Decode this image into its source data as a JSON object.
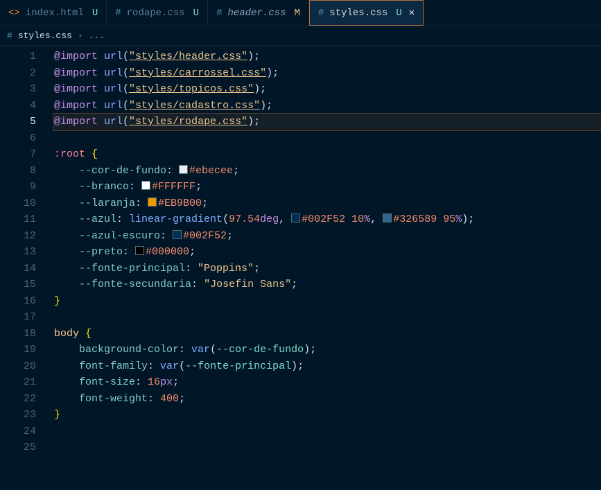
{
  "tabs": [
    {
      "icon": "html",
      "label": "index.html",
      "mod": "U",
      "modClass": "u",
      "active": false,
      "italic": false
    },
    {
      "icon": "css",
      "label": "rodape.css",
      "mod": "U",
      "modClass": "u",
      "active": false,
      "italic": false
    },
    {
      "icon": "css",
      "label": "header.css",
      "mod": "M",
      "modClass": "m",
      "active": false,
      "italic": true
    },
    {
      "icon": "css",
      "label": "styles.css",
      "mod": "U",
      "modClass": "u",
      "active": true,
      "italic": false,
      "closable": true
    }
  ],
  "breadcrumb": {
    "icon": "css",
    "file": "styles.css",
    "trail": "..."
  },
  "currentLine": 5,
  "glyphs": {
    "close": "✕",
    "crumbSep": "›",
    "htmlIcon": "<>",
    "cssIcon": "#"
  },
  "code": [
    {
      "n": 1,
      "seg": [
        [
          "at",
          "@import "
        ],
        [
          "fn",
          "url"
        ],
        [
          "paren",
          "("
        ],
        [
          "str",
          "\"styles/header.css\""
        ],
        [
          "paren",
          ")"
        ],
        [
          "punc",
          ";"
        ]
      ]
    },
    {
      "n": 2,
      "seg": [
        [
          "at",
          "@import "
        ],
        [
          "fn",
          "url"
        ],
        [
          "paren",
          "("
        ],
        [
          "str",
          "\"styles/carrossel.css\""
        ],
        [
          "paren",
          ")"
        ],
        [
          "punc",
          ";"
        ]
      ]
    },
    {
      "n": 3,
      "seg": [
        [
          "at",
          "@import "
        ],
        [
          "fn",
          "url"
        ],
        [
          "paren",
          "("
        ],
        [
          "str",
          "\"styles/topicos.css\""
        ],
        [
          "paren",
          ")"
        ],
        [
          "punc",
          ";"
        ]
      ]
    },
    {
      "n": 4,
      "seg": [
        [
          "at",
          "@import "
        ],
        [
          "fn",
          "url"
        ],
        [
          "paren",
          "("
        ],
        [
          "str",
          "\"styles/cadastro.css\""
        ],
        [
          "paren",
          ")"
        ],
        [
          "punc",
          ";"
        ]
      ]
    },
    {
      "n": 5,
      "hl": true,
      "seg": [
        [
          "at",
          "@import "
        ],
        [
          "fn",
          "url"
        ],
        [
          "paren",
          "("
        ],
        [
          "str",
          "\"styles/rodape.css\""
        ],
        [
          "paren",
          ")"
        ],
        [
          "punc",
          ";"
        ]
      ]
    },
    {
      "n": 6,
      "seg": []
    },
    {
      "n": 7,
      "seg": [
        [
          "sel2",
          ":root"
        ],
        [
          "punc",
          " "
        ],
        [
          "brace",
          "{"
        ]
      ]
    },
    {
      "n": 8,
      "seg": [
        [
          "prop",
          "    --cor-de-fundo"
        ],
        [
          "punc",
          ": "
        ],
        [
          "swatch",
          "#ebecee"
        ],
        [
          "hex",
          "#ebecee"
        ],
        [
          "punc",
          ";"
        ]
      ]
    },
    {
      "n": 9,
      "seg": [
        [
          "prop",
          "    --branco"
        ],
        [
          "punc",
          ": "
        ],
        [
          "swatch",
          "#FFFFFF"
        ],
        [
          "hex",
          "#FFFFFF"
        ],
        [
          "punc",
          ";"
        ]
      ]
    },
    {
      "n": 10,
      "seg": [
        [
          "prop",
          "    --laranja"
        ],
        [
          "punc",
          ": "
        ],
        [
          "swatch",
          "#EB9B00"
        ],
        [
          "hex",
          "#EB9B00"
        ],
        [
          "punc",
          ";"
        ]
      ]
    },
    {
      "n": 11,
      "seg": [
        [
          "prop",
          "    --azul"
        ],
        [
          "punc",
          ": "
        ],
        [
          "fn",
          "linear-gradient"
        ],
        [
          "paren",
          "("
        ],
        [
          "num",
          "97.54"
        ],
        [
          "unit",
          "deg"
        ],
        [
          "punc",
          ", "
        ],
        [
          "swatch",
          "#002F52"
        ],
        [
          "hex",
          "#002F52"
        ],
        [
          "punc",
          " "
        ],
        [
          "num",
          "10"
        ],
        [
          "unit",
          "%"
        ],
        [
          "punc",
          ", "
        ],
        [
          "swatch",
          "#326589"
        ],
        [
          "hex",
          "#326589"
        ],
        [
          "punc",
          " "
        ],
        [
          "num",
          "95"
        ],
        [
          "unit",
          "%"
        ],
        [
          "paren",
          ")"
        ],
        [
          "punc",
          ";"
        ]
      ]
    },
    {
      "n": 12,
      "seg": [
        [
          "prop",
          "    --azul-escuro"
        ],
        [
          "punc",
          ": "
        ],
        [
          "swatch",
          "#002F52"
        ],
        [
          "hex",
          "#002F52"
        ],
        [
          "punc",
          ";"
        ]
      ]
    },
    {
      "n": 13,
      "seg": [
        [
          "prop",
          "    --preto"
        ],
        [
          "punc",
          ": "
        ],
        [
          "swatch",
          "#000000"
        ],
        [
          "hex",
          "#000000"
        ],
        [
          "punc",
          ";"
        ]
      ]
    },
    {
      "n": 14,
      "seg": [
        [
          "prop",
          "    --fonte-principal"
        ],
        [
          "punc",
          ": "
        ],
        [
          "strp",
          "\"Poppins\""
        ],
        [
          "punc",
          ";"
        ]
      ]
    },
    {
      "n": 15,
      "seg": [
        [
          "prop",
          "    --fonte-secundaria"
        ],
        [
          "punc",
          ": "
        ],
        [
          "strp",
          "\"Josefin Sans\""
        ],
        [
          "punc",
          ";"
        ]
      ]
    },
    {
      "n": 16,
      "seg": [
        [
          "brace",
          "}"
        ]
      ]
    },
    {
      "n": 17,
      "seg": []
    },
    {
      "n": 18,
      "seg": [
        [
          "sel",
          "body"
        ],
        [
          "punc",
          " "
        ],
        [
          "brace",
          "{"
        ]
      ]
    },
    {
      "n": 19,
      "seg": [
        [
          "prop",
          "    background-color"
        ],
        [
          "punc",
          ": "
        ],
        [
          "fn",
          "var"
        ],
        [
          "paren",
          "("
        ],
        [
          "var",
          "--cor-de-fundo"
        ],
        [
          "paren",
          ")"
        ],
        [
          "punc",
          ";"
        ]
      ]
    },
    {
      "n": 20,
      "seg": [
        [
          "prop",
          "    font-family"
        ],
        [
          "punc",
          ": "
        ],
        [
          "fn",
          "var"
        ],
        [
          "paren",
          "("
        ],
        [
          "var",
          "--fonte-principal"
        ],
        [
          "paren",
          ")"
        ],
        [
          "punc",
          ";"
        ]
      ]
    },
    {
      "n": 21,
      "seg": [
        [
          "prop",
          "    font-size"
        ],
        [
          "punc",
          ": "
        ],
        [
          "num",
          "16"
        ],
        [
          "unit",
          "px"
        ],
        [
          "punc",
          ";"
        ]
      ]
    },
    {
      "n": 22,
      "seg": [
        [
          "prop",
          "    font-weight"
        ],
        [
          "punc",
          ": "
        ],
        [
          "num",
          "400"
        ],
        [
          "punc",
          ";"
        ]
      ]
    },
    {
      "n": 23,
      "seg": [
        [
          "brace",
          "}"
        ]
      ]
    },
    {
      "n": 24,
      "seg": []
    },
    {
      "n": 25,
      "seg": []
    }
  ]
}
